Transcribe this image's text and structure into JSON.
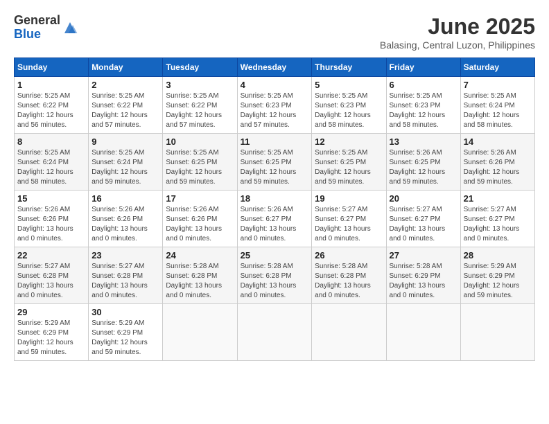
{
  "logo": {
    "general": "General",
    "blue": "Blue"
  },
  "title": {
    "month_year": "June 2025",
    "location": "Balasing, Central Luzon, Philippines"
  },
  "calendar": {
    "headers": [
      "Sunday",
      "Monday",
      "Tuesday",
      "Wednesday",
      "Thursday",
      "Friday",
      "Saturday"
    ],
    "weeks": [
      [
        {
          "day": "",
          "info": ""
        },
        {
          "day": "",
          "info": ""
        },
        {
          "day": "",
          "info": ""
        },
        {
          "day": "",
          "info": ""
        },
        {
          "day": "",
          "info": ""
        },
        {
          "day": "",
          "info": ""
        },
        {
          "day": "",
          "info": ""
        }
      ]
    ]
  },
  "days": {
    "1": {
      "rise": "5:25 AM",
      "set": "6:22 PM",
      "hours": "12",
      "mins": "56"
    },
    "2": {
      "rise": "5:25 AM",
      "set": "6:22 PM",
      "hours": "12",
      "mins": "57"
    },
    "3": {
      "rise": "5:25 AM",
      "set": "6:22 PM",
      "hours": "12",
      "mins": "57"
    },
    "4": {
      "rise": "5:25 AM",
      "set": "6:23 PM",
      "hours": "12",
      "mins": "57"
    },
    "5": {
      "rise": "5:25 AM",
      "set": "6:23 PM",
      "hours": "12",
      "mins": "58"
    },
    "6": {
      "rise": "5:25 AM",
      "set": "6:23 PM",
      "hours": "12",
      "mins": "58"
    },
    "7": {
      "rise": "5:25 AM",
      "set": "6:24 PM",
      "hours": "12",
      "mins": "58"
    },
    "8": {
      "rise": "5:25 AM",
      "set": "6:24 PM",
      "hours": "12",
      "mins": "58"
    },
    "9": {
      "rise": "5:25 AM",
      "set": "6:24 PM",
      "hours": "12",
      "mins": "59"
    },
    "10": {
      "rise": "5:25 AM",
      "set": "6:25 PM",
      "hours": "12",
      "mins": "59"
    },
    "11": {
      "rise": "5:25 AM",
      "set": "6:25 PM",
      "hours": "12",
      "mins": "59"
    },
    "12": {
      "rise": "5:25 AM",
      "set": "6:25 PM",
      "hours": "12",
      "mins": "59"
    },
    "13": {
      "rise": "5:26 AM",
      "set": "6:25 PM",
      "hours": "12",
      "mins": "59"
    },
    "14": {
      "rise": "5:26 AM",
      "set": "6:26 PM",
      "hours": "12",
      "mins": "59"
    },
    "15": {
      "rise": "5:26 AM",
      "set": "6:26 PM",
      "hours": "13",
      "mins": "0"
    },
    "16": {
      "rise": "5:26 AM",
      "set": "6:26 PM",
      "hours": "13",
      "mins": "0"
    },
    "17": {
      "rise": "5:26 AM",
      "set": "6:26 PM",
      "hours": "13",
      "mins": "0"
    },
    "18": {
      "rise": "5:26 AM",
      "set": "6:27 PM",
      "hours": "13",
      "mins": "0"
    },
    "19": {
      "rise": "5:27 AM",
      "set": "6:27 PM",
      "hours": "13",
      "mins": "0"
    },
    "20": {
      "rise": "5:27 AM",
      "set": "6:27 PM",
      "hours": "13",
      "mins": "0"
    },
    "21": {
      "rise": "5:27 AM",
      "set": "6:27 PM",
      "hours": "13",
      "mins": "0"
    },
    "22": {
      "rise": "5:27 AM",
      "set": "6:28 PM",
      "hours": "13",
      "mins": "0"
    },
    "23": {
      "rise": "5:27 AM",
      "set": "6:28 PM",
      "hours": "13",
      "mins": "0"
    },
    "24": {
      "rise": "5:28 AM",
      "set": "6:28 PM",
      "hours": "13",
      "mins": "0"
    },
    "25": {
      "rise": "5:28 AM",
      "set": "6:28 PM",
      "hours": "13",
      "mins": "0"
    },
    "26": {
      "rise": "5:28 AM",
      "set": "6:28 PM",
      "hours": "13",
      "mins": "0"
    },
    "27": {
      "rise": "5:28 AM",
      "set": "6:29 PM",
      "hours": "13",
      "mins": "0"
    },
    "28": {
      "rise": "5:29 AM",
      "set": "6:29 PM",
      "hours": "12",
      "mins": "59"
    },
    "29": {
      "rise": "5:29 AM",
      "set": "6:29 PM",
      "hours": "12",
      "mins": "59"
    },
    "30": {
      "rise": "5:29 AM",
      "set": "6:29 PM",
      "hours": "12",
      "mins": "59"
    }
  }
}
